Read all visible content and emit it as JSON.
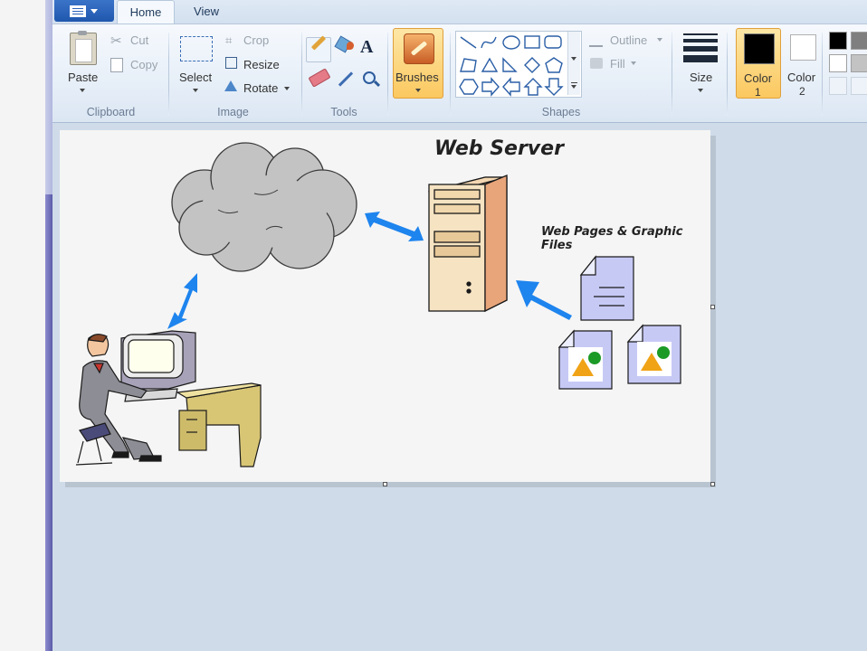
{
  "ribbon": {
    "tabs": [
      {
        "label": "Home",
        "active": true
      },
      {
        "label": "View",
        "active": false
      }
    ],
    "clipboard": {
      "paste": "Paste",
      "cut": "Cut",
      "copy": "Copy",
      "group": "Clipboard"
    },
    "image": {
      "select": "Select",
      "crop": "Crop",
      "resize": "Resize",
      "rotate": "Rotate",
      "group": "Image"
    },
    "tools": {
      "group": "Tools"
    },
    "brushes": {
      "label": "Brushes"
    },
    "shapes": {
      "outline": "Outline",
      "fill": "Fill",
      "group": "Shapes"
    },
    "size": {
      "label": "Size"
    },
    "colors": {
      "color1_label": "Color",
      "color1_num": "1",
      "color2_label": "Color",
      "color2_num": "2",
      "color1_value": "#000000",
      "color2_value": "#ffffff",
      "palette": [
        "#000000",
        "#7f7f7f",
        "#ffffff",
        "#c3c3c3"
      ]
    }
  },
  "canvas": {
    "title": "Web Server",
    "files_label": "Web Pages & Graphic Files",
    "accent_arrow_color": "#1e84ee"
  }
}
